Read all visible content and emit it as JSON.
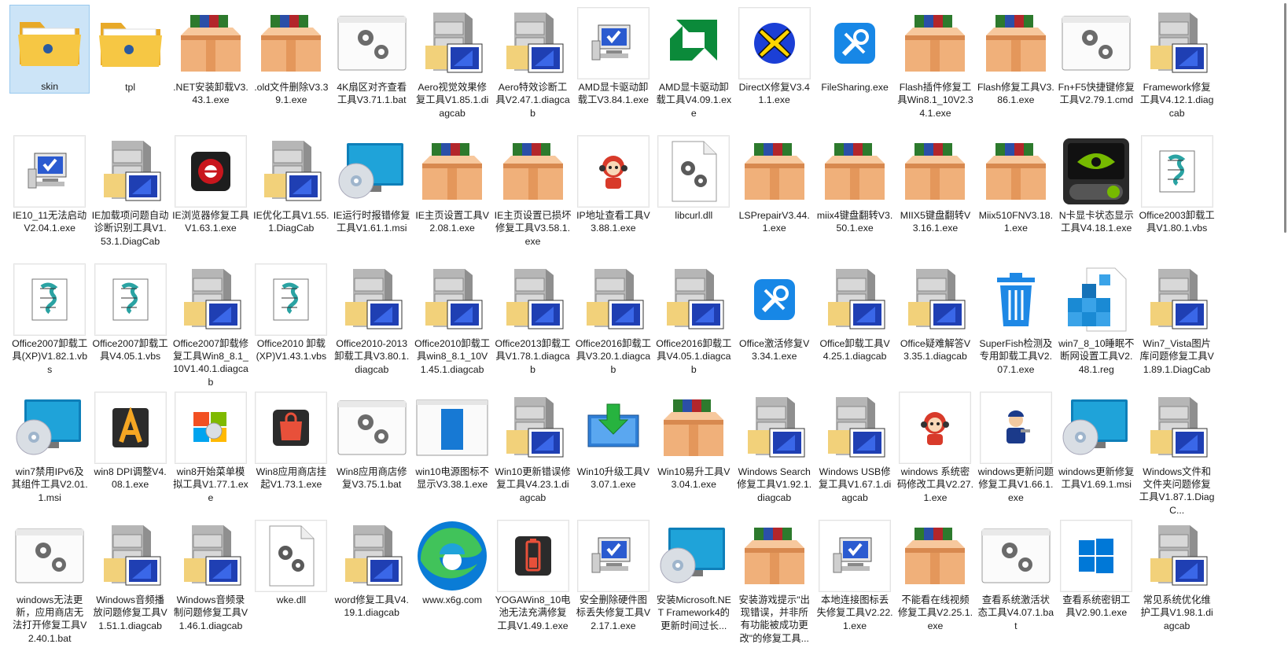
{
  "items": [
    {
      "label": "skin",
      "icon": "folder-icon",
      "selected": true
    },
    {
      "label": "tpl",
      "icon": "folder-icon"
    },
    {
      "label": ".NET安装卸载V3.43.1.exe",
      "icon": "package-box-icon"
    },
    {
      "label": ".old文件删除V3.39.1.exe",
      "icon": "package-box-icon"
    },
    {
      "label": "4K扇区对齐查看工具V3.71.1.bat",
      "icon": "settings-window-icon"
    },
    {
      "label": "Aero视觉效果修复工具V1.85.1.diagcab",
      "icon": "cabinet-icon"
    },
    {
      "label": "Aero特效诊断工具V2.47.1.diagcab",
      "icon": "cabinet-icon"
    },
    {
      "label": "AMD显卡驱动卸载工V3.84.1.exe",
      "icon": "computer-check-icon"
    },
    {
      "label": "AMD显卡驱动卸载工具V4.09.1.exe",
      "icon": "amd-logo-icon"
    },
    {
      "label": "DirectX修复V3.41.1.exe",
      "icon": "directx-icon"
    },
    {
      "label": "FileSharing.exe",
      "icon": "tools-icon"
    },
    {
      "label": "Flash插件修复工具Win8.1_10V2.34.1.exe",
      "icon": "package-box-icon"
    },
    {
      "label": "Flash修复工具V3.86.1.exe",
      "icon": "package-box-icon"
    },
    {
      "label": "Fn+F5快捷键修复工具V2.79.1.cmd",
      "icon": "settings-window-icon"
    },
    {
      "label": "Framework修复工具V4.12.1.diagcab",
      "icon": "cabinet-icon"
    },
    {
      "label": "IE10_11无法启动V2.04.1.exe",
      "icon": "computer-check-icon"
    },
    {
      "label": "IE加载项问题自动诊断识别工具V1.53.1.DiagCab",
      "icon": "cabinet-icon"
    },
    {
      "label": "IE浏览器修复工具V1.63.1.exe",
      "icon": "ie-red-icon"
    },
    {
      "label": "IE优化工具V1.55.1.DiagCab",
      "icon": "cabinet-icon"
    },
    {
      "label": "IE运行时报错修复工具V1.61.1.msi",
      "icon": "monitor-disc-icon"
    },
    {
      "label": "IE主页设置工具V2.08.1.exe",
      "icon": "package-box-icon"
    },
    {
      "label": "IE主页设置已损坏修复工具V3.58.1.exe",
      "icon": "package-box-icon"
    },
    {
      "label": "IP地址查看工具V3.88.1.exe",
      "icon": "mascot-icon"
    },
    {
      "label": "libcurl.dll",
      "icon": "dll-file-icon"
    },
    {
      "label": "LSPrepairV3.44.1.exe",
      "icon": "package-box-icon"
    },
    {
      "label": "miix4键盘翻转V3.50.1.exe",
      "icon": "package-box-icon"
    },
    {
      "label": "MIIX5键盘翻转V3.16.1.exe",
      "icon": "package-box-icon"
    },
    {
      "label": "Miix510FNV3.18.1.exe",
      "icon": "package-box-icon"
    },
    {
      "label": "N卡显卡状态显示工具V4.18.1.exe",
      "icon": "nvidia-icon"
    },
    {
      "label": "Office2003卸载工具V1.80.1.vbs",
      "icon": "script-icon"
    },
    {
      "label": "Office2007卸载工具(XP)V1.82.1.vbs",
      "icon": "script-icon"
    },
    {
      "label": "Office2007卸载工具V4.05.1.vbs",
      "icon": "script-icon"
    },
    {
      "label": "Office2007卸载修复工具Win8_8.1_10V1.40.1.diagcab",
      "icon": "cabinet-icon"
    },
    {
      "label": "Office2010 卸载(XP)V1.43.1.vbs",
      "icon": "script-icon"
    },
    {
      "label": "Office2010-2013卸载工具V3.80.1.diagcab",
      "icon": "cabinet-icon"
    },
    {
      "label": "Office2010卸载工具win8_8.1_10V1.45.1.diagcab",
      "icon": "cabinet-icon"
    },
    {
      "label": "Office2013卸载工具V1.78.1.diagcab",
      "icon": "cabinet-icon"
    },
    {
      "label": "Office2016卸载工具V3.20.1.diagcab",
      "icon": "cabinet-icon"
    },
    {
      "label": "Office2016卸载工具V4.05.1.diagcab",
      "icon": "cabinet-icon"
    },
    {
      "label": "Office激活修复V3.34.1.exe",
      "icon": "tools-icon"
    },
    {
      "label": "Office卸载工具V4.25.1.diagcab",
      "icon": "cabinet-icon"
    },
    {
      "label": "Office疑难解答V3.35.1.diagcab",
      "icon": "cabinet-icon"
    },
    {
      "label": "SuperFish检测及专用卸载工具V2.07.1.exe",
      "icon": "trash-icon"
    },
    {
      "label": "win7_8_10睡眠不断网设置工具V2.48.1.reg",
      "icon": "registry-icon"
    },
    {
      "label": "Win7_Vista图片库问题修复工具V1.89.1.DiagCab",
      "icon": "cabinet-icon"
    },
    {
      "label": "win7禁用IPv6及其组件工具V2.01.1.msi",
      "icon": "monitor-disc-icon"
    },
    {
      "label": "win8 DPI调整V4.08.1.exe",
      "icon": "font-a-icon"
    },
    {
      "label": "win8开始菜单模拟工具V1.77.1.exe",
      "icon": "windows-install-icon"
    },
    {
      "label": "Win8应用商店挂起V1.73.1.exe",
      "icon": "store-bag-icon"
    },
    {
      "label": "Win8应用商店修复V3.75.1.bat",
      "icon": "settings-window-icon"
    },
    {
      "label": "win10电源图标不显示V3.38.1.exe",
      "icon": "window-blue-icon"
    },
    {
      "label": "Win10更新错误修复工具V4.23.1.diagcab",
      "icon": "cabinet-icon"
    },
    {
      "label": "Win10升级工具V3.07.1.exe",
      "icon": "download-monitor-icon"
    },
    {
      "label": "Win10易升工具V3.04.1.exe",
      "icon": "package-box-icon"
    },
    {
      "label": "Windows Search修复工具V1.92.1.diagcab",
      "icon": "cabinet-icon"
    },
    {
      "label": "Windows USB修复工具V1.67.1.diagcab",
      "icon": "cabinet-icon"
    },
    {
      "label": "windows 系统密码修改工具V2.27.1.exe",
      "icon": "mascot-icon"
    },
    {
      "label": "windows更新问题修复工具V1.66.1.exe",
      "icon": "technician-icon"
    },
    {
      "label": "windows更新修复工具V1.69.1.msi",
      "icon": "monitor-disc-icon"
    },
    {
      "label": "Windows文件和文件夹问题修复工具V1.87.1.DiagC...",
      "icon": "cabinet-icon"
    },
    {
      "label": "windows无法更新，应用商店无法打开修复工具V2.40.1.bat",
      "icon": "settings-window-icon"
    },
    {
      "label": "Windows音频播放问题修复工具V1.51.1.diagcab",
      "icon": "cabinet-icon"
    },
    {
      "label": "Windows音频录制问题修复工具V1.46.1.diagcab",
      "icon": "cabinet-icon"
    },
    {
      "label": "wke.dll",
      "icon": "dll-file-icon"
    },
    {
      "label": "word修复工具V4.19.1.diagcab",
      "icon": "cabinet-icon"
    },
    {
      "label": "www.x6g.com",
      "icon": "edge-icon"
    },
    {
      "label": "YOGAWin8_10电池无法充满修复工具V1.49.1.exe",
      "icon": "battery-icon"
    },
    {
      "label": "安全删除硬件图标丢失修复工具V2.17.1.exe",
      "icon": "computer-check-icon"
    },
    {
      "label": "安装Microsoft.NET Framework4的更新时间过长...",
      "icon": "monitor-disc-icon"
    },
    {
      "label": "安装游戏提示\"出现错误，并非所有功能被成功更改\"的修复工具...",
      "icon": "package-box-icon"
    },
    {
      "label": "本地连接图标丢失修复工具V2.22.1.exe",
      "icon": "computer-check-icon"
    },
    {
      "label": "不能看在线视频修复工具V2.25.1.exe",
      "icon": "package-box-icon"
    },
    {
      "label": "查看系统激活状态工具V4.07.1.bat",
      "icon": "settings-window-icon"
    },
    {
      "label": "查看系统密钥工具V2.90.1.exe",
      "icon": "windows-logo-icon"
    },
    {
      "label": "常见系统优化维护工具V1.98.1.diagcab",
      "icon": "cabinet-icon"
    }
  ],
  "colors": {
    "selection_bg": "#cce4f7",
    "folder_yellow": "#f6c744",
    "windows_blue": "#0078d7"
  }
}
